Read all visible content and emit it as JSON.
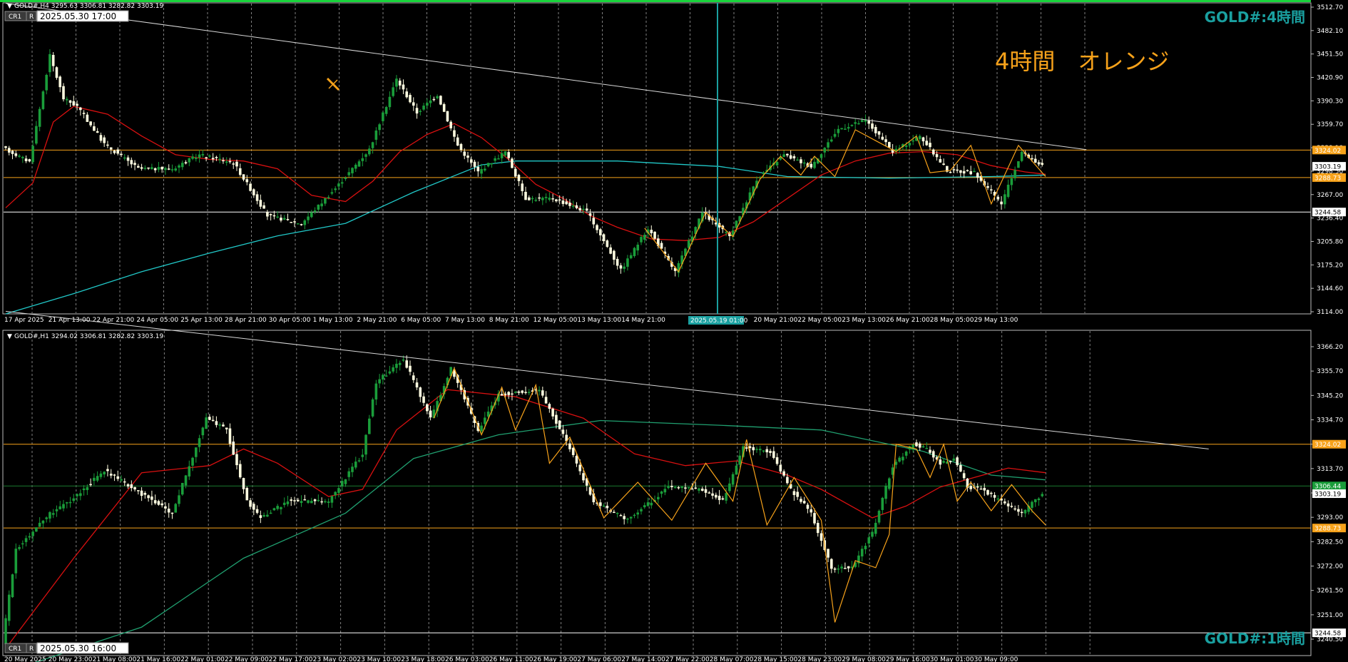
{
  "top_panel": {
    "header": "GOLD#,H4  3295.63 3306.81 3282.82 3303.19",
    "corner_btn_1": "CR1",
    "corner_btn_2": "R",
    "date_box": "2025.05.30 17:00",
    "watermark": "GOLD#:4時間",
    "annotation": "4時間　オレンジ",
    "crosshair_label": "2025.05.19 01:00",
    "price_ticks": [
      "3512.70",
      "3482.10",
      "3451.50",
      "3420.90",
      "3390.30",
      "3359.70",
      "3329.10",
      "3298.50",
      "3267.00",
      "3236.40",
      "3205.80",
      "3175.20",
      "3144.60",
      "3114.00"
    ],
    "time_ticks": [
      "17 Apr 2025",
      "21 Apr 13:00",
      "22 Apr 21:00",
      "24 Apr 05:00",
      "25 Apr 13:00",
      "28 Apr 21:00",
      "30 Apr 05:00",
      "1 May 13:00",
      "2 May 21:00",
      "6 May 05:00",
      "7 May 13:00",
      "8 May 21:00",
      "12 May 05:00",
      "13 May 13:00",
      "14 May 21:00",
      "",
      "May 13:00",
      "20 May 21:00",
      "22 May 05:00",
      "23 May 13:00",
      "26 May 21:00",
      "28 May 05:00",
      "29 May 13:00"
    ],
    "level_tags": [
      {
        "label": "3324.02",
        "value": 3324.02,
        "color": "#f7a21a"
      },
      {
        "label": "3303.19",
        "value": 3303.19,
        "color": "#ffffff"
      },
      {
        "label": "3288.73",
        "value": 3288.73,
        "color": "#f7a21a"
      },
      {
        "label": "3244.58",
        "value": 3244.58,
        "color": "#ffffff"
      }
    ]
  },
  "bottom_panel": {
    "header": "GOLD#,H1  3294.02 3306.81 3282.82 3303.19",
    "corner_btn_1": "CR1",
    "corner_btn_2": "R",
    "date_box": "2025.05.30 16:00",
    "watermark": "GOLD#:1時間",
    "price_ticks": [
      "3366.20",
      "3355.70",
      "3345.20",
      "3334.70",
      "3324.20",
      "3313.70",
      "3303.20",
      "3293.00",
      "3282.50",
      "3272.00",
      "3261.50",
      "3251.00",
      "3240.50"
    ],
    "time_ticks": [
      "20 May 2025",
      "20 May 23:00",
      "21 May 08:00",
      "21 May 16:00",
      "22 May 01:00",
      "22 May 09:00",
      "22 May 17:00",
      "23 May 02:00",
      "23 May 10:00",
      "23 May 18:00",
      "26 May 03:00",
      "26 May 11:00",
      "26 May 19:00",
      "27 May 06:00",
      "27 May 14:00",
      "27 May 22:00",
      "28 May 07:00",
      "28 May 15:00",
      "28 May 23:00",
      "29 May 08:00",
      "29 May 16:00",
      "30 May 01:00",
      "30 May 09:00"
    ],
    "level_tags": [
      {
        "label": "3324.02",
        "value": 3324.02,
        "color": "#f7a21a"
      },
      {
        "label": "3306.44",
        "value": 3306.44,
        "color": "#1a9d3a"
      },
      {
        "label": "3303.19",
        "value": 3303.19,
        "color": "#ffffff"
      },
      {
        "label": "3288.73",
        "value": 3288.73,
        "color": "#f7a21a"
      },
      {
        "label": "3244.58",
        "value": 3244.58,
        "color": "#ffffff"
      }
    ]
  },
  "colors": {
    "bull": "#1a9d3a",
    "bear": "#fffde0",
    "ma_fast": "#d81010",
    "ma_slow_top": "#21c8c8",
    "ma_slow_bottom": "#20a070",
    "zigzag": "#f7a21a",
    "level": "#f7a21a",
    "trendline": "#d8d8d8",
    "watermark": "#1aa0a0",
    "annotation": "#f7a21a",
    "grid": "#7f7f7f"
  },
  "chart_data": [
    {
      "type": "candlestick",
      "title": "GOLD#:4時間",
      "ylim": [
        3114.0,
        3512.7
      ],
      "anchors": [
        [
          0,
          3327
        ],
        [
          8,
          3309
        ],
        [
          14,
          3445
        ],
        [
          18,
          3390
        ],
        [
          22,
          3380
        ],
        [
          30,
          3332
        ],
        [
          40,
          3300
        ],
        [
          50,
          3300
        ],
        [
          58,
          3318
        ],
        [
          68,
          3308
        ],
        [
          78,
          3240
        ],
        [
          88,
          3230
        ],
        [
          98,
          3275
        ],
        [
          108,
          3325
        ],
        [
          116,
          3415
        ],
        [
          122,
          3372
        ],
        [
          128,
          3395
        ],
        [
          134,
          3330
        ],
        [
          140,
          3296
        ],
        [
          148,
          3322
        ],
        [
          154,
          3262
        ],
        [
          162,
          3262
        ],
        [
          172,
          3245
        ],
        [
          182,
          3170
        ],
        [
          190,
          3224
        ],
        [
          198,
          3168
        ],
        [
          206,
          3244
        ],
        [
          214,
          3213
        ],
        [
          222,
          3287
        ],
        [
          230,
          3318
        ],
        [
          238,
          3303
        ],
        [
          246,
          3351
        ],
        [
          254,
          3362
        ],
        [
          262,
          3322
        ],
        [
          270,
          3342
        ],
        [
          278,
          3298
        ],
        [
          286,
          3295
        ],
        [
          294,
          3255
        ],
        [
          300,
          3322
        ],
        [
          306,
          3303
        ]
      ],
      "ma_fast": [
        [
          0,
          3250
        ],
        [
          8,
          3282
        ],
        [
          14,
          3360
        ],
        [
          20,
          3380
        ],
        [
          30,
          3370
        ],
        [
          40,
          3342
        ],
        [
          50,
          3318
        ],
        [
          60,
          3312
        ],
        [
          70,
          3310
        ],
        [
          80,
          3300
        ],
        [
          90,
          3266
        ],
        [
          100,
          3258
        ],
        [
          108,
          3284
        ],
        [
          116,
          3322
        ],
        [
          124,
          3344
        ],
        [
          132,
          3358
        ],
        [
          140,
          3340
        ],
        [
          148,
          3312
        ],
        [
          156,
          3280
        ],
        [
          164,
          3262
        ],
        [
          172,
          3240
        ],
        [
          180,
          3225
        ],
        [
          190,
          3210
        ],
        [
          200,
          3208
        ],
        [
          210,
          3212
        ],
        [
          220,
          3232
        ],
        [
          230,
          3262
        ],
        [
          240,
          3292
        ],
        [
          250,
          3310
        ],
        [
          260,
          3320
        ],
        [
          270,
          3322
        ],
        [
          280,
          3318
        ],
        [
          290,
          3304
        ],
        [
          300,
          3296
        ],
        [
          306,
          3293
        ]
      ],
      "ma_slow": [
        [
          0,
          3114
        ],
        [
          20,
          3140
        ],
        [
          40,
          3168
        ],
        [
          60,
          3192
        ],
        [
          80,
          3214
        ],
        [
          100,
          3230
        ],
        [
          120,
          3270
        ],
        [
          140,
          3305
        ],
        [
          150,
          3310
        ],
        [
          180,
          3310
        ],
        [
          210,
          3303
        ],
        [
          230,
          3290
        ],
        [
          260,
          3288
        ],
        [
          290,
          3290
        ],
        [
          306,
          3292
        ]
      ],
      "zigzag": [
        [
          188,
          3224
        ],
        [
          198,
          3168
        ],
        [
          206,
          3244
        ],
        [
          214,
          3213
        ],
        [
          222,
          3287
        ],
        [
          228,
          3316
        ],
        [
          234,
          3292
        ],
        [
          238,
          3316
        ],
        [
          244,
          3290
        ],
        [
          250,
          3350
        ],
        [
          256,
          3336
        ],
        [
          262,
          3322
        ],
        [
          268,
          3342
        ],
        [
          272,
          3295
        ],
        [
          278,
          3298
        ],
        [
          284,
          3330
        ],
        [
          290,
          3255
        ],
        [
          298,
          3330
        ],
        [
          306,
          3290
        ]
      ],
      "trendline": [
        [
          0,
          3512
        ],
        [
          318,
          3324.5
        ]
      ],
      "levels": [
        3324.02,
        3288.73,
        3244.58
      ]
    },
    {
      "type": "candlestick",
      "title": "GOLD#:1時間",
      "ylim": [
        3235.0,
        3372.0
      ],
      "anchors": [
        [
          0,
          3240
        ],
        [
          4,
          3280
        ],
        [
          14,
          3295
        ],
        [
          20,
          3300
        ],
        [
          30,
          3313
        ],
        [
          50,
          3295
        ],
        [
          60,
          3335
        ],
        [
          66,
          3330
        ],
        [
          72,
          3300
        ],
        [
          76,
          3293
        ],
        [
          84,
          3300
        ],
        [
          96,
          3300
        ],
        [
          106,
          3320
        ],
        [
          110,
          3350
        ],
        [
          118,
          3360
        ],
        [
          126,
          3335
        ],
        [
          132,
          3356
        ],
        [
          140,
          3330
        ],
        [
          146,
          3345
        ],
        [
          158,
          3347
        ],
        [
          166,
          3325
        ],
        [
          174,
          3300
        ],
        [
          184,
          3292
        ],
        [
          196,
          3306
        ],
        [
          206,
          3305
        ],
        [
          212,
          3300
        ],
        [
          218,
          3323
        ],
        [
          226,
          3321
        ],
        [
          232,
          3305
        ],
        [
          238,
          3295
        ],
        [
          244,
          3272
        ],
        [
          250,
          3272
        ],
        [
          256,
          3287
        ],
        [
          262,
          3315
        ],
        [
          268,
          3324
        ],
        [
          272,
          3322
        ],
        [
          276,
          3316
        ],
        [
          280,
          3318
        ],
        [
          284,
          3306
        ],
        [
          288,
          3305
        ],
        [
          300,
          3295
        ],
        [
          306,
          3303
        ]
      ],
      "ma_fast": [
        [
          0,
          3238
        ],
        [
          20,
          3276
        ],
        [
          40,
          3312
        ],
        [
          60,
          3315
        ],
        [
          70,
          3322
        ],
        [
          80,
          3316
        ],
        [
          95,
          3302
        ],
        [
          105,
          3305
        ],
        [
          115,
          3330
        ],
        [
          130,
          3347
        ],
        [
          150,
          3344
        ],
        [
          170,
          3335
        ],
        [
          185,
          3320
        ],
        [
          200,
          3315
        ],
        [
          215,
          3317
        ],
        [
          230,
          3311
        ],
        [
          240,
          3305
        ],
        [
          255,
          3293
        ],
        [
          265,
          3298
        ],
        [
          275,
          3306
        ],
        [
          285,
          3310
        ],
        [
          295,
          3314
        ],
        [
          306,
          3312
        ]
      ],
      "ma_slow": [
        [
          0,
          3228
        ],
        [
          40,
          3247
        ],
        [
          70,
          3276
        ],
        [
          100,
          3295
        ],
        [
          120,
          3318
        ],
        [
          145,
          3328
        ],
        [
          175,
          3334
        ],
        [
          210,
          3332
        ],
        [
          240,
          3330
        ],
        [
          270,
          3321
        ],
        [
          290,
          3311
        ],
        [
          306,
          3309
        ]
      ],
      "zigzag": [
        [
          126,
          3335
        ],
        [
          132,
          3356
        ],
        [
          140,
          3328
        ],
        [
          146,
          3348
        ],
        [
          150,
          3330
        ],
        [
          156,
          3349
        ],
        [
          160,
          3316
        ],
        [
          166,
          3327
        ],
        [
          176,
          3293
        ],
        [
          186,
          3308
        ],
        [
          196,
          3292
        ],
        [
          206,
          3316
        ],
        [
          214,
          3300
        ],
        [
          218,
          3326
        ],
        [
          224,
          3290
        ],
        [
          232,
          3310
        ],
        [
          240,
          3292
        ],
        [
          244,
          3249
        ],
        [
          250,
          3275
        ],
        [
          256,
          3272
        ],
        [
          260,
          3286
        ],
        [
          262,
          3324
        ],
        [
          268,
          3322
        ],
        [
          272,
          3310
        ],
        [
          276,
          3324
        ],
        [
          280,
          3300
        ],
        [
          284,
          3308
        ],
        [
          290,
          3296
        ],
        [
          296,
          3307
        ],
        [
          302,
          3296
        ],
        [
          306,
          3290
        ]
      ],
      "trendline": [
        [
          0,
          3380
        ],
        [
          354,
          3322
        ]
      ],
      "levels": [
        3324.02,
        3306.44,
        3288.73,
        3244.58
      ]
    }
  ]
}
